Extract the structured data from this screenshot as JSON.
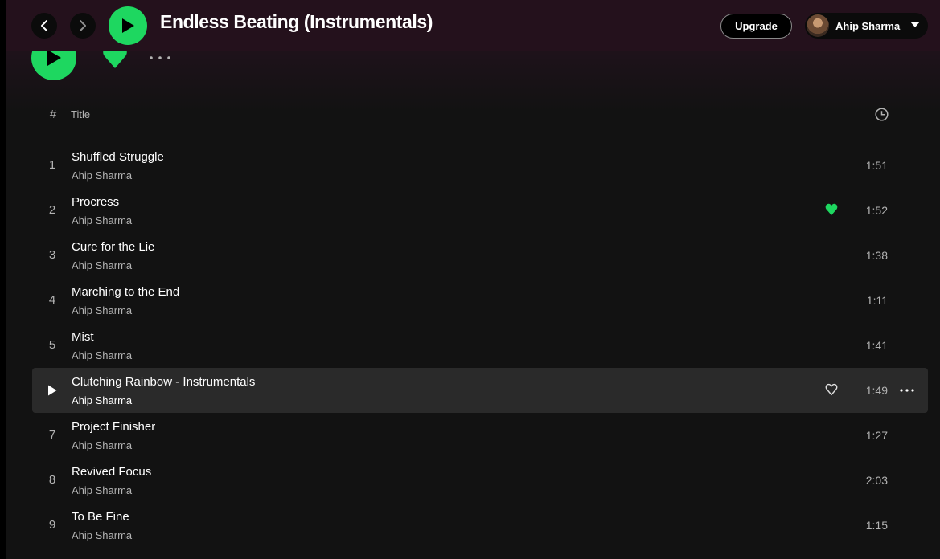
{
  "header": {
    "title": "Endless Beating (Instrumentals)",
    "upgrade_label": "Upgrade",
    "user_name": "Ahip Sharma"
  },
  "colors": {
    "accent": "#1ed760",
    "background": "#121212",
    "header_tint": "#24111c",
    "row_hover": "#2a2a2a",
    "secondary_text": "#b3b3b3"
  },
  "icons": {
    "back": "chevron-left-icon",
    "forward": "chevron-right-icon",
    "play": "play-icon",
    "liked": "heart-filled-icon",
    "like": "heart-outline-icon",
    "more": "more-horizontal-icon",
    "duration": "clock-icon",
    "user_menu": "caret-down-icon"
  },
  "table": {
    "col_number": "#",
    "col_title": "Title"
  },
  "tracks": [
    {
      "number": "1",
      "title": "Shuffled Struggle",
      "artist": "Ahip Sharma",
      "duration": "1:51",
      "liked": false,
      "hover": false
    },
    {
      "number": "2",
      "title": "Procress",
      "artist": "Ahip Sharma",
      "duration": "1:52",
      "liked": true,
      "hover": false
    },
    {
      "number": "3",
      "title": "Cure for the Lie",
      "artist": "Ahip Sharma",
      "duration": "1:38",
      "liked": false,
      "hover": false
    },
    {
      "number": "4",
      "title": "Marching to the End",
      "artist": "Ahip Sharma",
      "duration": "1:11",
      "liked": false,
      "hover": false
    },
    {
      "number": "5",
      "title": "Mist",
      "artist": "Ahip Sharma",
      "duration": "1:41",
      "liked": false,
      "hover": false
    },
    {
      "number": "6",
      "title": "Clutching Rainbow - Instrumentals",
      "artist": "Ahip Sharma",
      "duration": "1:49",
      "liked": false,
      "hover": true
    },
    {
      "number": "7",
      "title": "Project Finisher",
      "artist": "Ahip Sharma",
      "duration": "1:27",
      "liked": false,
      "hover": false
    },
    {
      "number": "8",
      "title": "Revived Focus",
      "artist": "Ahip Sharma",
      "duration": "2:03",
      "liked": false,
      "hover": false
    },
    {
      "number": "9",
      "title": "To Be Fine",
      "artist": "Ahip Sharma",
      "duration": "1:15",
      "liked": false,
      "hover": false
    }
  ]
}
